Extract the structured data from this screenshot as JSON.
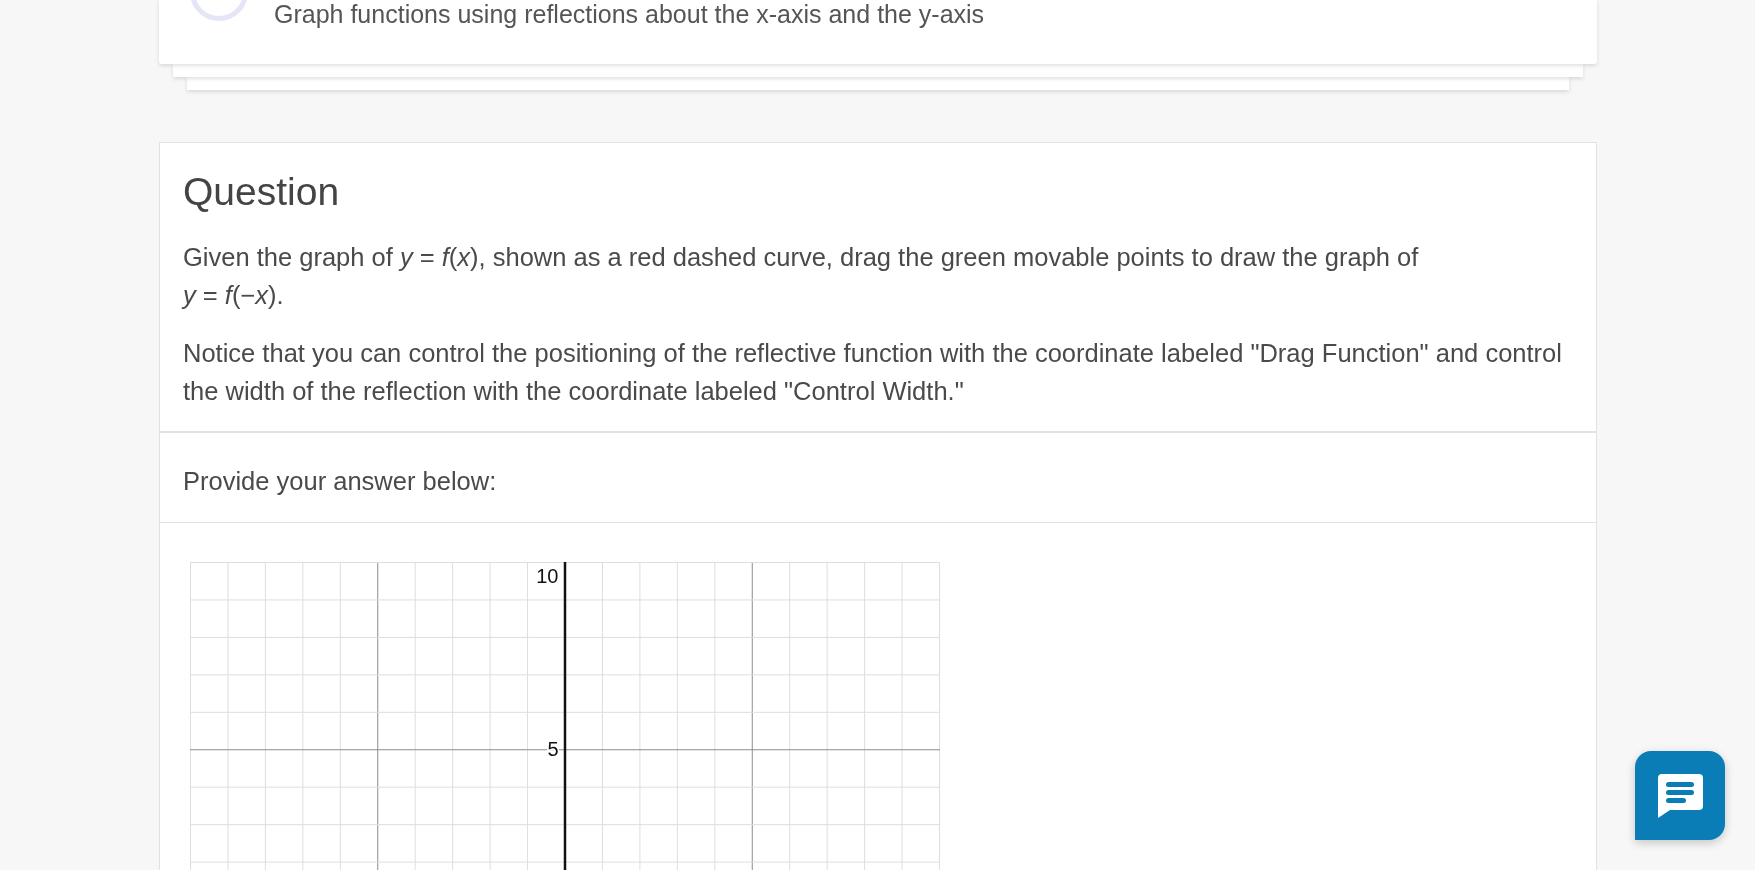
{
  "header_card": {
    "title": "Graph functions using reflections about the x-axis and the y-axis"
  },
  "question": {
    "heading": "Question",
    "paragraphs": [
      "Given the graph of *y* = *f*(*x*), shown as a red dashed curve, drag the green movable points to draw the graph of *y* = *f*(−*x*).",
      "Notice that you can control the positioning of the reflective function with the coordinate labeled \"Drag Function\" and control the width of the reflection with the coordinate labeled \"Control Width.\""
    ]
  },
  "answer": {
    "prompt": "Provide your answer below:",
    "graph": {
      "y_tick_labels": [
        "10",
        "5"
      ]
    }
  }
}
